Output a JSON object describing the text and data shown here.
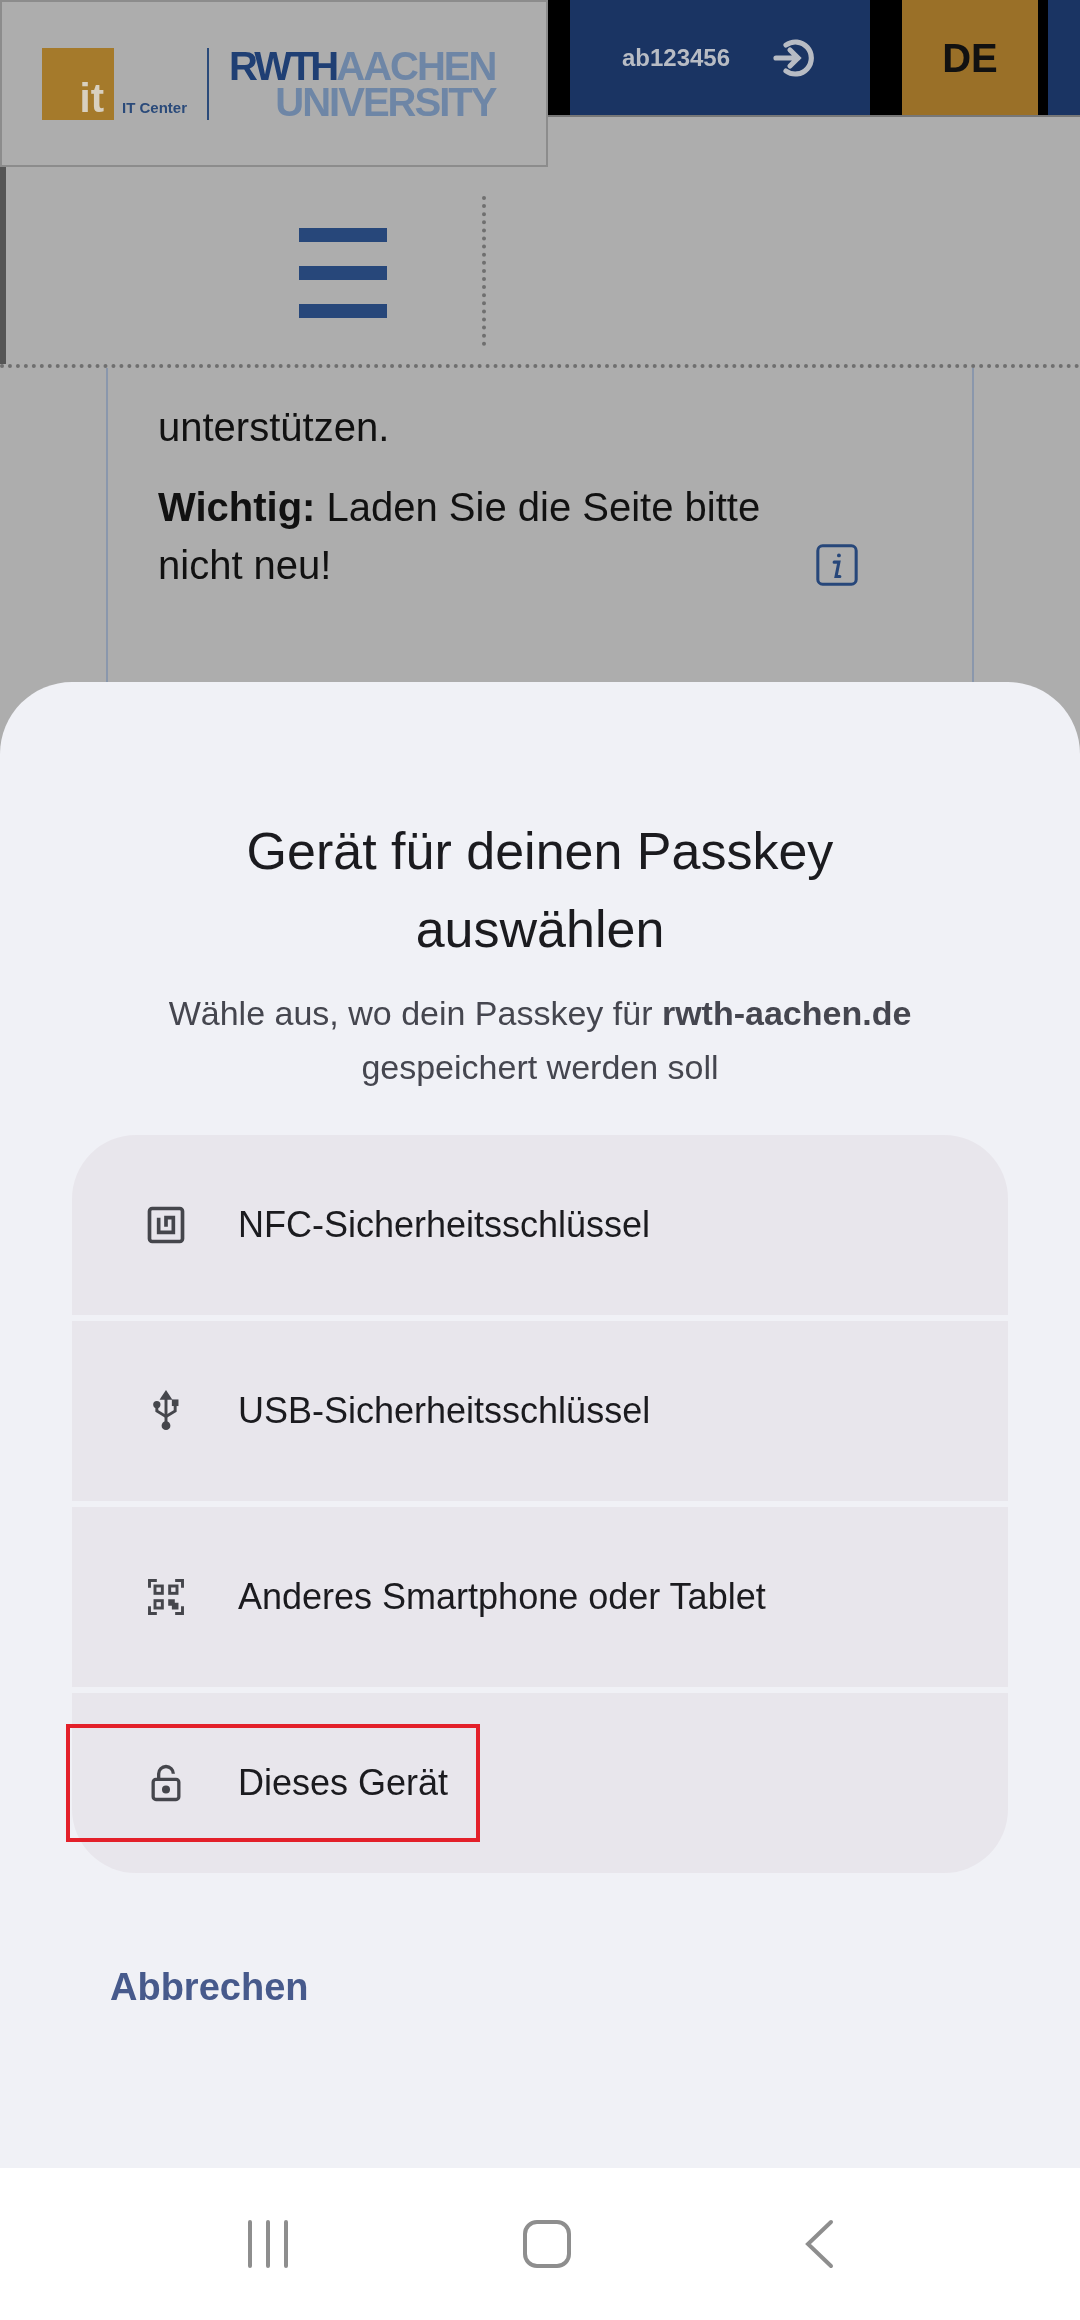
{
  "header": {
    "logo": {
      "badge": "it",
      "unit": "IT Center",
      "name_part_1": "RWTH",
      "name_part_2": "AACHEN",
      "name_part_3": "UNIVERSITY"
    },
    "user": "ab123456",
    "language": "DE"
  },
  "page": {
    "paragraphs": [
      "unterstützen.",
      "**Wichtig:** Laden Sie die Seite bitte nicht neu!"
    ]
  },
  "sheet": {
    "title": "Gerät für deinen Passkey auswählen",
    "subtitle": "Wähle aus, wo dein Passkey für **rwth-aachen.de** gespeichert werden soll",
    "options": [
      {
        "kind": "nfc",
        "label": "NFC-Sicherheitsschlüssel",
        "highlighted": false
      },
      {
        "kind": "usb",
        "label": "USB-Sicherheitsschlüssel",
        "highlighted": false
      },
      {
        "kind": "qr",
        "label": "Anderes Smartphone oder Tablet",
        "highlighted": false
      },
      {
        "kind": "lock",
        "label": "Dieses Gerät",
        "highlighted": true
      }
    ],
    "cancel": "Abbrechen"
  }
}
